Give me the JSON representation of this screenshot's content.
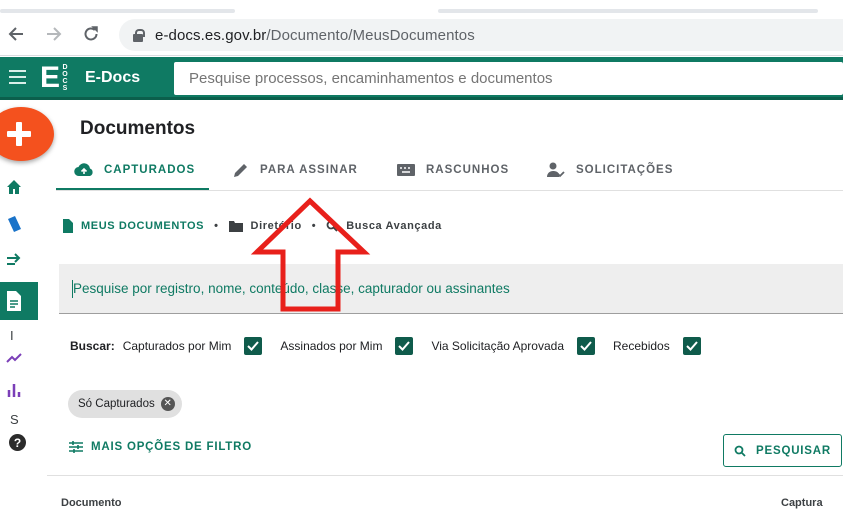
{
  "browser": {
    "url_host": "e-docs.es.gov.br",
    "url_path": "/Documento/MeusDocumentos"
  },
  "app": {
    "logo_letter": "E",
    "logo_sub": "DOCS",
    "name": "E-Docs",
    "search_placeholder": "Pesquise processos, encaminhamentos e documentos"
  },
  "sidebar": {
    "text_items": [
      "I",
      "S"
    ],
    "help": "?"
  },
  "page": {
    "title": "Documentos"
  },
  "tabs": [
    {
      "label": "CAPTURADOS",
      "icon": "cloud-upload-icon",
      "active": true
    },
    {
      "label": "PARA ASSINAR",
      "icon": "pen-icon",
      "active": false
    },
    {
      "label": "RASCUNHOS",
      "icon": "keyboard-icon",
      "active": false
    },
    {
      "label": "SOLICITAÇÕES",
      "icon": "person-check-icon",
      "active": false
    }
  ],
  "subnav": {
    "my_documents": "MEUS DOCUMENTOS",
    "directory": "Diretório",
    "advanced_search": "Busca Avançada"
  },
  "filter": {
    "placeholder": "Pesquise por registro, nome, conteúdo, classe, capturador ou assinantes"
  },
  "search_options": {
    "label": "Buscar:",
    "checkboxes": [
      {
        "label": "Capturados por Mim",
        "checked": true
      },
      {
        "label": "Assinados por Mim",
        "checked": true
      },
      {
        "label": "Via Solicitação Aprovada",
        "checked": true
      },
      {
        "label": "Recebidos",
        "checked": true
      }
    ]
  },
  "chip": {
    "label": "Só Capturados"
  },
  "actions": {
    "more_filters": "MAIS OPÇÕES DE FILTRO",
    "search": "PESQUISAR"
  },
  "table": {
    "columns": [
      "Documento",
      "Captura"
    ]
  },
  "colors": {
    "primary": "#0f7a63",
    "fab": "#f4511e",
    "annotation": "#e8201b"
  }
}
